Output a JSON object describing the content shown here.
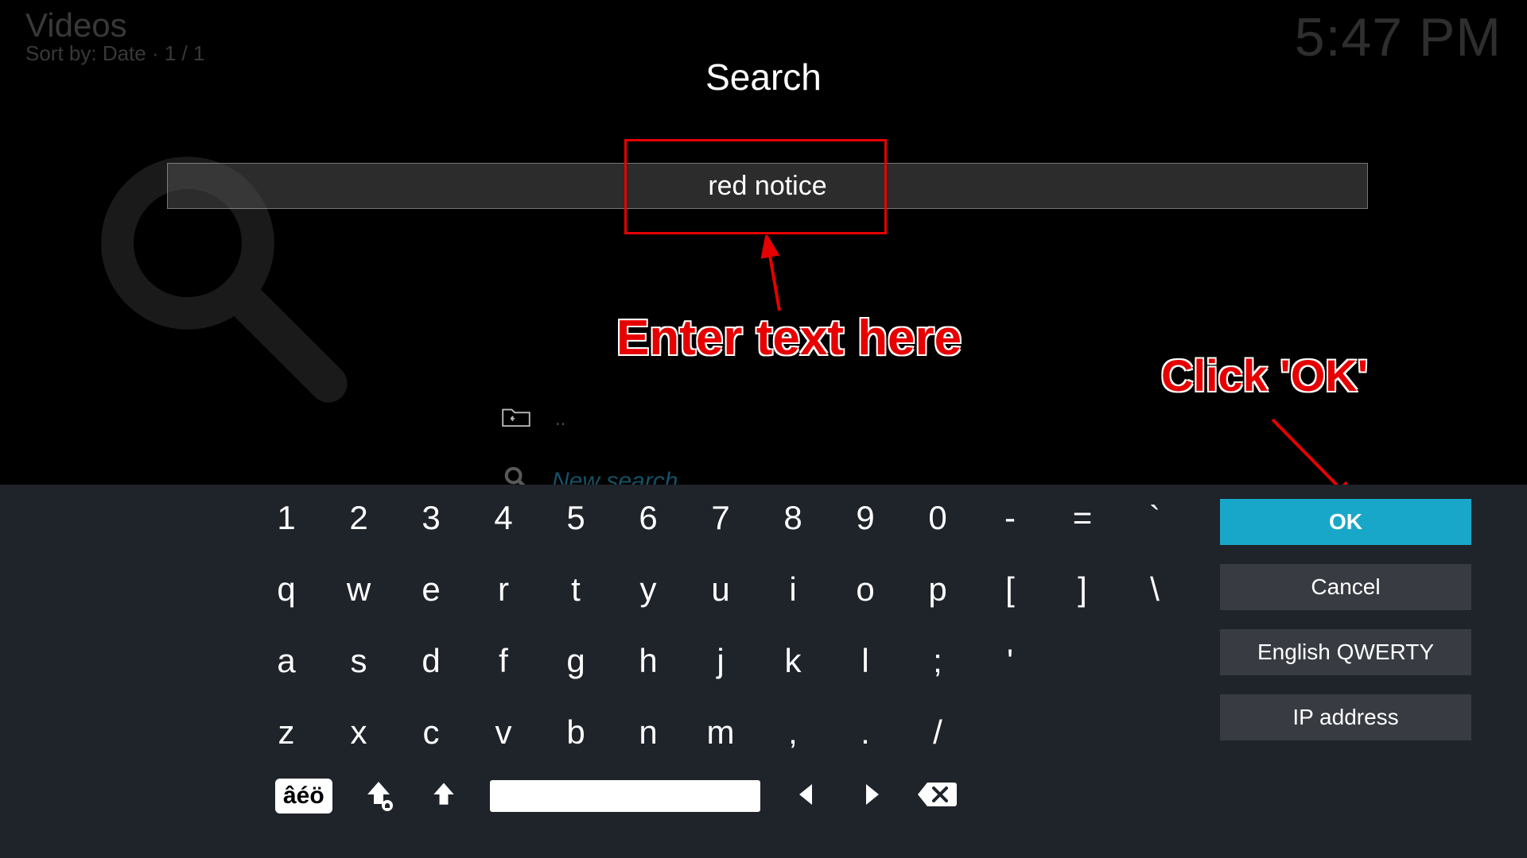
{
  "header": {
    "title": "Videos",
    "subtitle": "Sort by: Date  ·  1 / 1"
  },
  "clock": "5:47 PM",
  "dialog": {
    "title": "Search",
    "input_value": "red notice"
  },
  "list": {
    "back_label": "..",
    "new_search_label": "New search..."
  },
  "annotations": {
    "enter": "Enter text here",
    "click": "Click 'OK'"
  },
  "keyboard": {
    "rows": [
      [
        "1",
        "2",
        "3",
        "4",
        "5",
        "6",
        "7",
        "8",
        "9",
        "0",
        "-",
        "=",
        "`"
      ],
      [
        "q",
        "w",
        "e",
        "r",
        "t",
        "y",
        "u",
        "i",
        "o",
        "p",
        "[",
        "]",
        "\\"
      ],
      [
        "a",
        "s",
        "d",
        "f",
        "g",
        "h",
        "j",
        "k",
        "l",
        ";",
        "'"
      ],
      [
        "z",
        "x",
        "c",
        "v",
        "b",
        "n",
        "m",
        ",",
        ".",
        "/"
      ]
    ],
    "accent_label": "âéö"
  },
  "side_buttons": {
    "ok": "OK",
    "cancel": "Cancel",
    "layout": "English QWERTY",
    "ip": "IP address"
  }
}
